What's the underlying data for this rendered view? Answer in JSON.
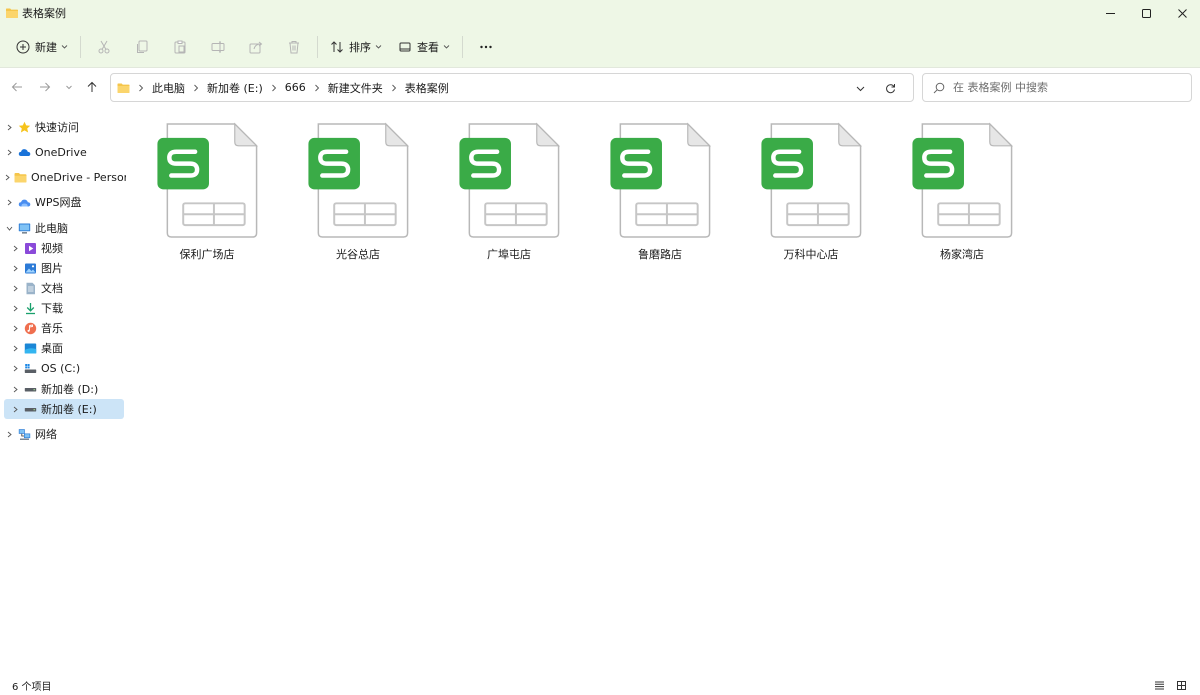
{
  "window": {
    "title": "表格案例",
    "accent": "#eef7e6",
    "controls": [
      "minimize-icon",
      "maximize-icon",
      "close-icon"
    ]
  },
  "toolbar": {
    "new_label": "新建",
    "sort_label": "排序",
    "view_label": "查看",
    "icons": [
      "cut-icon",
      "copy-icon",
      "paste-icon",
      "rename-icon",
      "share-icon",
      "delete-icon",
      "more-icon"
    ]
  },
  "address": {
    "crumbs": [
      "此电脑",
      "新加卷 (E:)",
      "666",
      "新建文件夹",
      "表格案例"
    ]
  },
  "search": {
    "placeholder": "在 表格案例 中搜索"
  },
  "sidebar": {
    "items": [
      {
        "label": "快速访问",
        "icon": "star-icon"
      },
      {
        "label": "OneDrive",
        "icon": "cloud-icon"
      },
      {
        "label": "OneDrive - Person",
        "icon": "folder-icon"
      },
      {
        "label": "WPS网盘",
        "icon": "wps-cloud-icon"
      },
      {
        "label": "此电脑",
        "icon": "computer-icon"
      },
      {
        "label": "视频",
        "icon": "video-icon"
      },
      {
        "label": "图片",
        "icon": "picture-icon"
      },
      {
        "label": "文档",
        "icon": "document-icon"
      },
      {
        "label": "下载",
        "icon": "download-icon"
      },
      {
        "label": "音乐",
        "icon": "music-icon"
      },
      {
        "label": "桌面",
        "icon": "desktop-icon"
      },
      {
        "label": "OS (C:)",
        "icon": "drive-c-icon"
      },
      {
        "label": "新加卷 (D:)",
        "icon": "drive-icon"
      },
      {
        "label": "新加卷 (E:)",
        "icon": "drive-icon"
      },
      {
        "label": "网络",
        "icon": "network-icon"
      }
    ],
    "selected": "新加卷 (E:)"
  },
  "files": [
    {
      "name": "保利广场店",
      "icon": "wps-spreadsheet-icon"
    },
    {
      "name": "光谷总店",
      "icon": "wps-spreadsheet-icon"
    },
    {
      "name": "广埠屯店",
      "icon": "wps-spreadsheet-icon"
    },
    {
      "name": "鲁磨路店",
      "icon": "wps-spreadsheet-icon"
    },
    {
      "name": "万科中心店",
      "icon": "wps-spreadsheet-icon"
    },
    {
      "name": "杨家湾店",
      "icon": "wps-spreadsheet-icon"
    }
  ],
  "file_icon_color": "#3aab47",
  "status": {
    "count": "6 个项目"
  }
}
